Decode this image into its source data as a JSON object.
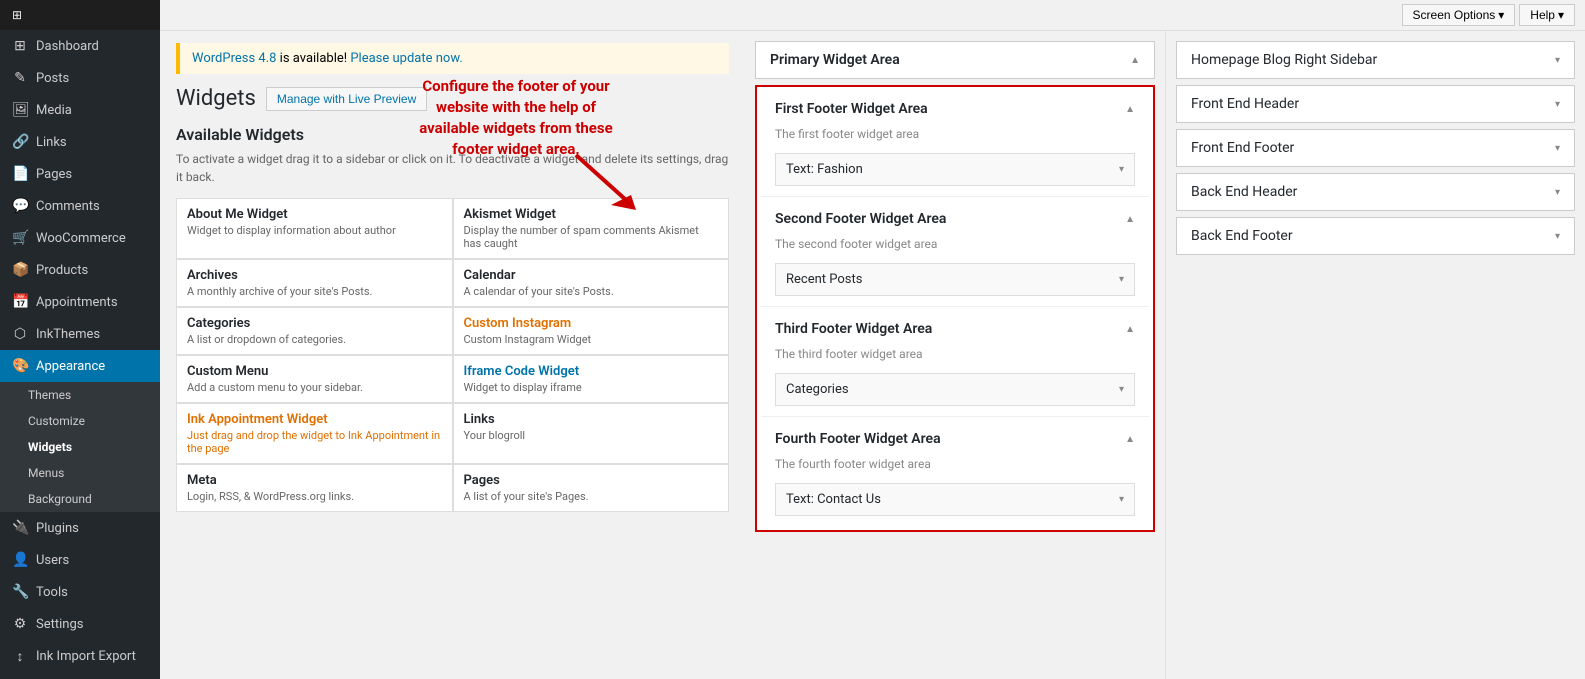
{
  "topbar": {
    "screen_options": "Screen Options",
    "help": "Help"
  },
  "sidebar": {
    "logo": "WordPress",
    "items": [
      {
        "id": "dashboard",
        "label": "Dashboard",
        "icon": "⊞"
      },
      {
        "id": "posts",
        "label": "Posts",
        "icon": "✎"
      },
      {
        "id": "media",
        "label": "Media",
        "icon": "🖼"
      },
      {
        "id": "links",
        "label": "Links",
        "icon": "🔗"
      },
      {
        "id": "pages",
        "label": "Pages",
        "icon": "📄"
      },
      {
        "id": "comments",
        "label": "Comments",
        "icon": "💬"
      },
      {
        "id": "woocommerce",
        "label": "WooCommerce",
        "icon": "🛒"
      },
      {
        "id": "products",
        "label": "Products",
        "icon": "📦"
      },
      {
        "id": "appointments",
        "label": "Appointments",
        "icon": "📅"
      },
      {
        "id": "inkthemes",
        "label": "InkThemes",
        "icon": "⬡"
      },
      {
        "id": "appearance",
        "label": "Appearance",
        "icon": "🎨"
      },
      {
        "id": "plugins",
        "label": "Plugins",
        "icon": "🔌"
      },
      {
        "id": "users",
        "label": "Users",
        "icon": "👤"
      },
      {
        "id": "tools",
        "label": "Tools",
        "icon": "🔧"
      },
      {
        "id": "settings",
        "label": "Settings",
        "icon": "⚙"
      },
      {
        "id": "ink-import-export",
        "label": "Ink Import Export",
        "icon": "↕"
      }
    ],
    "appearance_sub": [
      {
        "id": "themes",
        "label": "Themes"
      },
      {
        "id": "customize",
        "label": "Customize"
      },
      {
        "id": "widgets",
        "label": "Widgets"
      },
      {
        "id": "menus",
        "label": "Menus"
      },
      {
        "id": "background",
        "label": "Background"
      }
    ]
  },
  "page": {
    "title": "Widgets",
    "live_preview_btn": "Manage with Live Preview",
    "update_notice_text": " is available! ",
    "update_notice_wp": "WordPress 4.8",
    "update_notice_link": "Please update now.",
    "available_widgets_title": "Available Widgets",
    "available_widgets_desc": "To activate a widget drag it to a sidebar or click on it. To deactivate a widget and delete its settings, drag it back.",
    "tooltip_text": "Configure the footer of your website with the help of available widgets from these footer widget area."
  },
  "widgets": [
    {
      "name": "About Me Widget",
      "desc": "Widget to display information about author",
      "style": "normal"
    },
    {
      "name": "Akismet Widget",
      "desc": "Display the number of spam comments Akismet has caught",
      "style": "normal"
    },
    {
      "name": "Archives",
      "desc": "A monthly archive of your site's Posts.",
      "style": "normal"
    },
    {
      "name": "Calendar",
      "desc": "A calendar of your site's Posts.",
      "style": "normal"
    },
    {
      "name": "Categories",
      "desc": "A list or dropdown of categories.",
      "style": "normal"
    },
    {
      "name": "Custom Instagram",
      "desc": "Custom Instagram Widget",
      "style": "orange"
    },
    {
      "name": "Custom Menu",
      "desc": "Add a custom menu to your sidebar.",
      "style": "normal"
    },
    {
      "name": "Iframe Code Widget",
      "desc": "Widget to display iframe",
      "style": "blue"
    },
    {
      "name": "Ink Appointment Widget",
      "desc": "Just drag and drop the widget to Ink Appointment in the page",
      "style": "orange"
    },
    {
      "name": "Links",
      "desc": "Your blogroll",
      "style": "normal"
    },
    {
      "name": "Meta",
      "desc": "Login, RSS, & WordPress.org links.",
      "style": "normal"
    },
    {
      "name": "Pages",
      "desc": "A list of your site's Pages.",
      "style": "normal"
    }
  ],
  "footer_areas": [
    {
      "id": "first-footer",
      "title": "First Footer Widget Area",
      "subtitle": "The first footer widget area",
      "widget": "Text: Fashion"
    },
    {
      "id": "second-footer",
      "title": "Second Footer Widget Area",
      "subtitle": "The second footer widget area",
      "widget": "Recent Posts"
    },
    {
      "id": "third-footer",
      "title": "Third Footer Widget Area",
      "subtitle": "The third footer widget area",
      "widget": "Categories"
    },
    {
      "id": "fourth-footer",
      "title": "Fourth Footer Widget Area",
      "subtitle": "The fourth footer widget area",
      "widget": "Text: Contact Us"
    }
  ],
  "right_sidebar_areas": [
    {
      "id": "primary",
      "title": "Primary Widget Area"
    },
    {
      "id": "homepage-blog",
      "title": "Homepage Blog Right Sidebar"
    },
    {
      "id": "front-end-header",
      "title": "Front End Header"
    },
    {
      "id": "front-end-footer",
      "title": "Front End Footer"
    },
    {
      "id": "back-end-header",
      "title": "Back End Header"
    },
    {
      "id": "back-end-footer",
      "title": "Back End Footer"
    }
  ]
}
